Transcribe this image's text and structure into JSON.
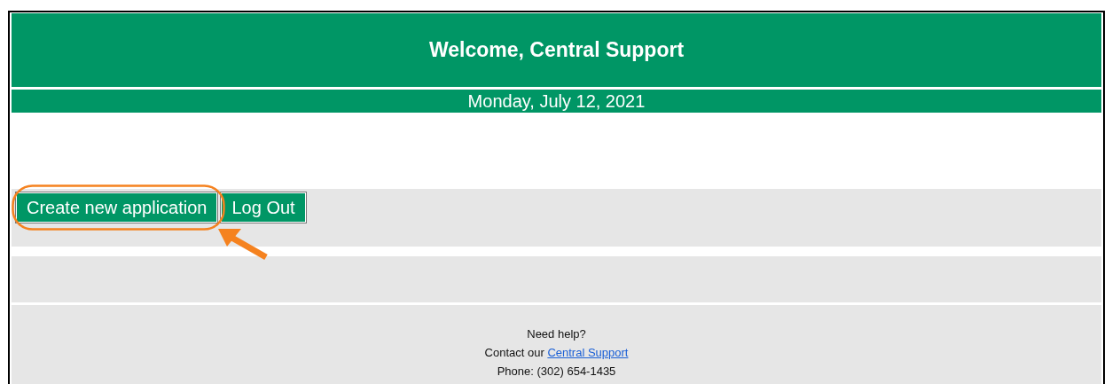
{
  "header": {
    "title": "Welcome, Central Support",
    "date": "Monday, July 12, 2021"
  },
  "buttons": [
    {
      "label": "Create new application",
      "highlighted": true
    },
    {
      "label": "Log Out",
      "highlighted": false
    }
  ],
  "footer": {
    "question": "Need help?",
    "contact_prefix": "Contact our",
    "contact_link": "Central Support",
    "phone": "Phone: (302) 654-1435"
  }
}
